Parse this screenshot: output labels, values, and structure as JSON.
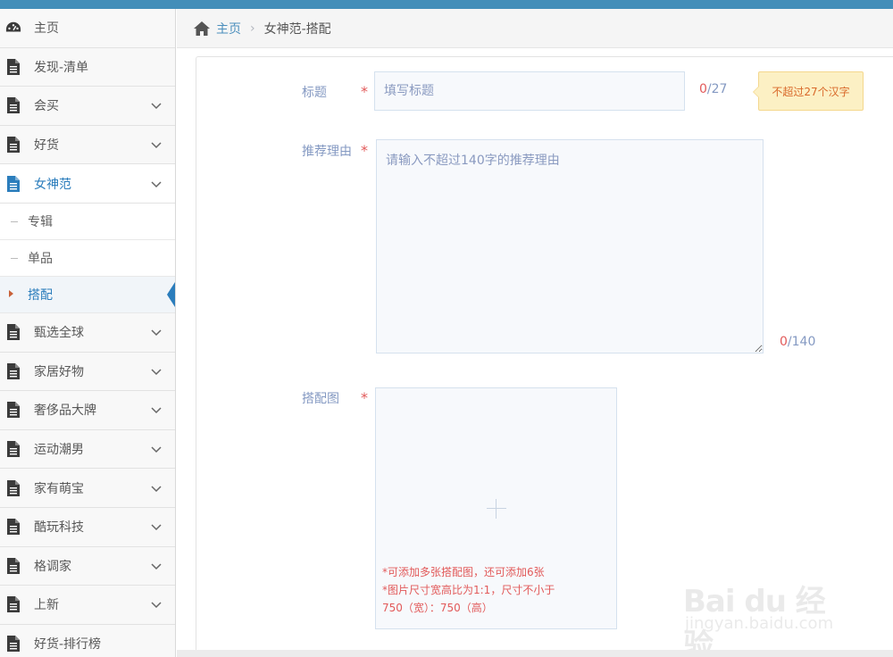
{
  "breadcrumb": {
    "home": "主页",
    "separator": "›",
    "current": "女神范-搭配"
  },
  "sidebar": {
    "items": [
      {
        "label": "主页",
        "icon": "dashboard-icon",
        "expandable": false
      },
      {
        "label": "发现-清单",
        "icon": "file-icon",
        "expandable": false
      },
      {
        "label": "会买",
        "icon": "file-icon",
        "expandable": true
      },
      {
        "label": "好货",
        "icon": "file-icon",
        "expandable": true
      },
      {
        "label": "女神范",
        "icon": "file-icon",
        "expandable": true,
        "open": true
      },
      {
        "label": "甄选全球",
        "icon": "file-icon",
        "expandable": true
      },
      {
        "label": "家居好物",
        "icon": "file-icon",
        "expandable": true
      },
      {
        "label": "奢侈品大牌",
        "icon": "file-icon",
        "expandable": true
      },
      {
        "label": "运动潮男",
        "icon": "file-icon",
        "expandable": true
      },
      {
        "label": "家有萌宝",
        "icon": "file-icon",
        "expandable": true
      },
      {
        "label": "酷玩科技",
        "icon": "file-icon",
        "expandable": true
      },
      {
        "label": "格调家",
        "icon": "file-icon",
        "expandable": true
      },
      {
        "label": "上新",
        "icon": "file-icon",
        "expandable": true
      },
      {
        "label": "好货-排行榜",
        "icon": "file-icon",
        "expandable": false
      }
    ],
    "subitems": [
      {
        "label": "专辑"
      },
      {
        "label": "单品"
      },
      {
        "label": "搭配",
        "active": true
      }
    ]
  },
  "form": {
    "title": {
      "label": "标题",
      "required_mark": "*",
      "placeholder": "填写标题",
      "value": "",
      "count": "0",
      "max": "/27",
      "tip": "不超过27个汉字"
    },
    "reason": {
      "label": "推荐理由",
      "required_mark": "*",
      "placeholder": "请输入不超过140字的推荐理由",
      "value": "",
      "count": "0",
      "max": "/140"
    },
    "image": {
      "label": "搭配图",
      "required_mark": "*",
      "hint1": "*可添加多张搭配图，还可添加6张",
      "hint2": "*图片尺寸宽高比为1:1，尺寸不小于",
      "hint3": "750（宽）：750（高）"
    }
  },
  "watermark": {
    "logo": "Bai du 经验",
    "url": "jingyan.baidu.com"
  },
  "colors": {
    "accent": "#2b7dbc",
    "topbar": "#438eb9",
    "required": "#e25a5a",
    "label": "#8499c2",
    "tip_bg": "#fcf0c4"
  }
}
